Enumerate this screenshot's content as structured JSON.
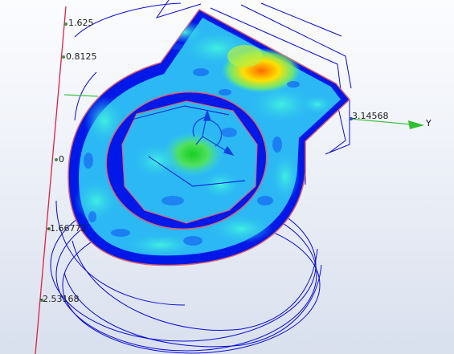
{
  "viewport": {
    "background_top": "#fbfcfe",
    "background_bottom": "#d9e0ee"
  },
  "colors": {
    "wireframe": "#0b0bd8",
    "outline": "#e0606a",
    "z_axis": "#e02040",
    "y_axis": "#40c040",
    "contour_low": "#0020f0",
    "contour_mid": "#20e0a0",
    "contour_high": "#ff6000"
  },
  "axis": {
    "z_ticks": [
      "1.625",
      "0.8125",
      "0",
      "-1.66772",
      "-2.53168"
    ],
    "y_tick": "3.14568",
    "y_label": "Y"
  },
  "icons": {
    "triad": "coordinate-triad-icon"
  }
}
